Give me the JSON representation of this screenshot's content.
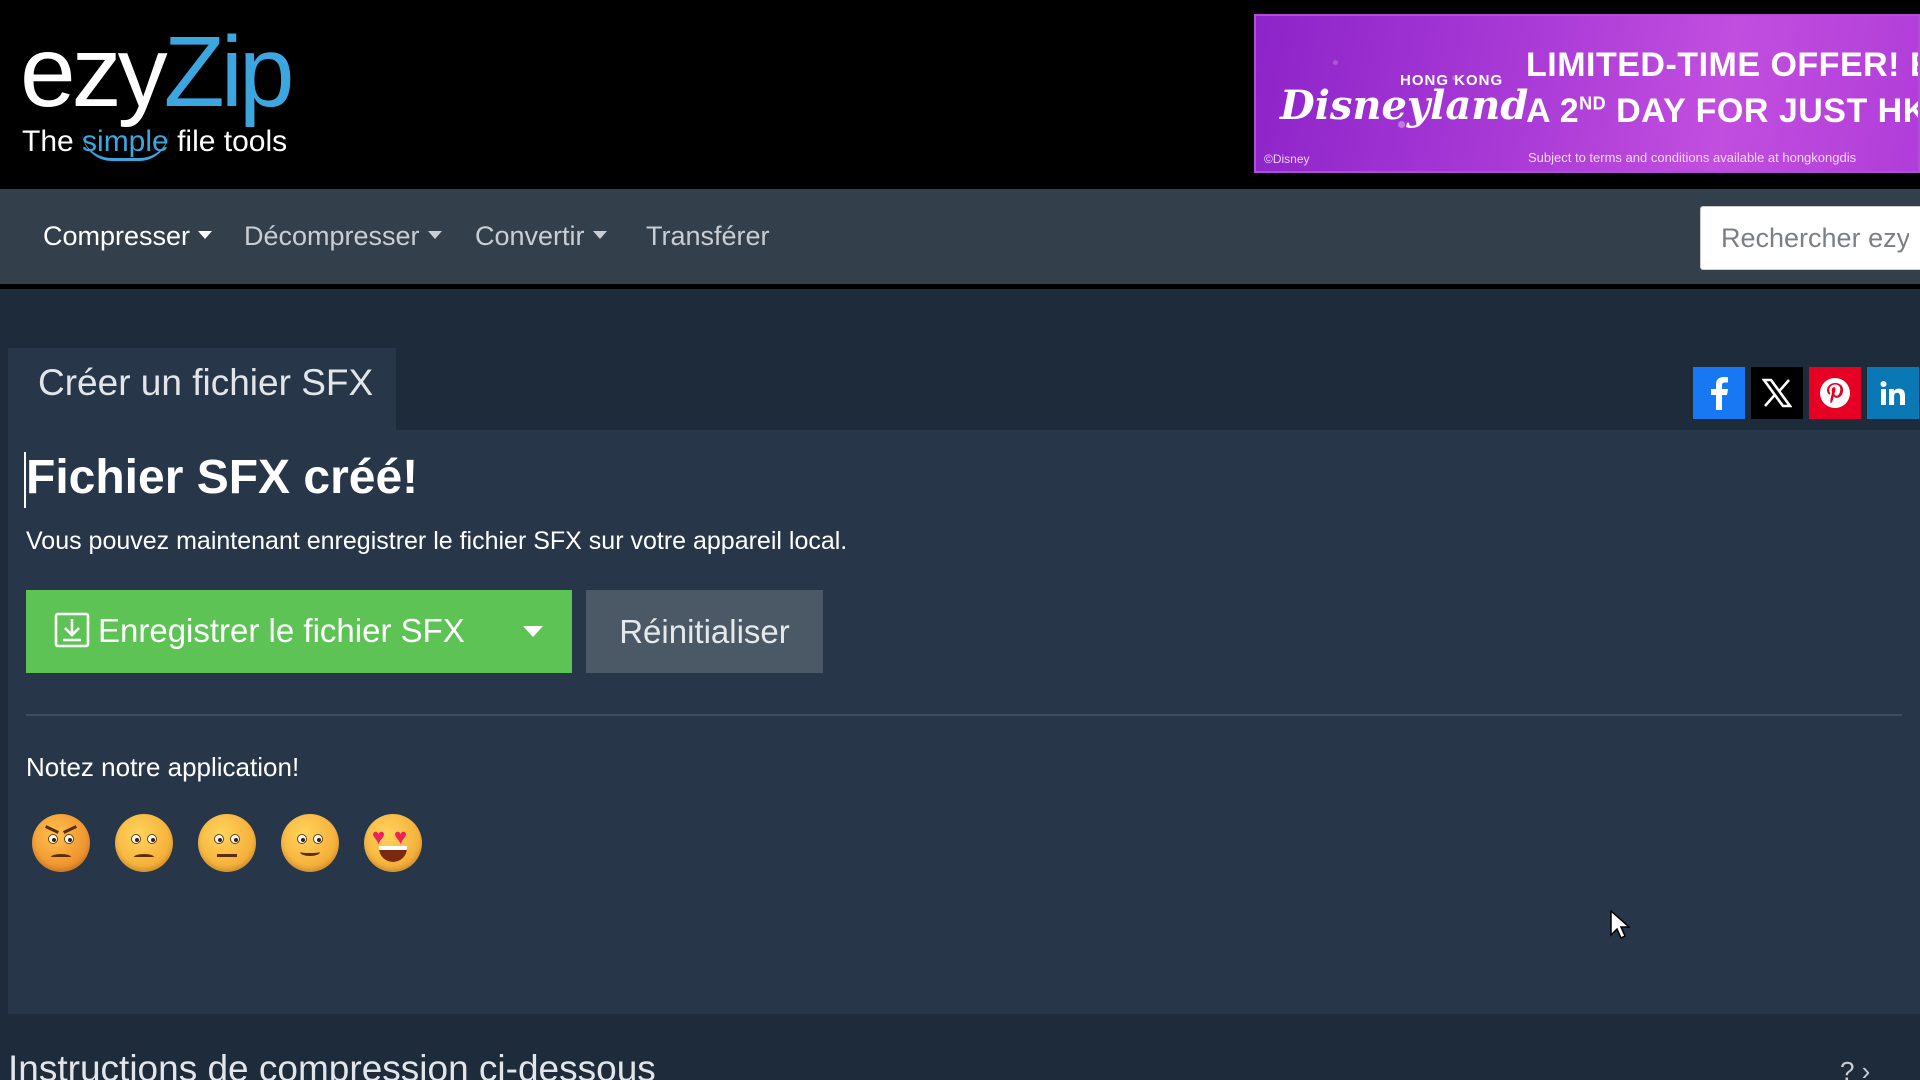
{
  "logo": {
    "part1": "ezy",
    "part2": "Zip",
    "tag_before": "The ",
    "tag_highlight": "simple",
    "tag_after": " file tools"
  },
  "ad": {
    "brand_small": "HONG KONG",
    "brand_name": "Disneyland",
    "line1": "LIMITED-TIME OFFER! EN",
    "line2_a": "A 2",
    "line2_sup": "ND",
    "line2_b": " DAY FOR JUST HK$",
    "fineprint": "Subject to terms and conditions available at hongkongdis",
    "copyright": "©Disney"
  },
  "nav": {
    "items": [
      {
        "label": "Compresser",
        "dropdown": true
      },
      {
        "label": "Décompresser",
        "dropdown": true
      },
      {
        "label": "Convertir",
        "dropdown": true
      },
      {
        "label": "Transférer",
        "dropdown": false
      }
    ],
    "search_placeholder": "Rechercher ezyZ"
  },
  "tab": {
    "label": "Créer un fichier SFX"
  },
  "social": [
    "facebook-icon",
    "x-icon",
    "pinterest-icon",
    "linkedin-icon"
  ],
  "main": {
    "title": "Fichier SFX créé!",
    "subtitle": "Vous pouvez maintenant enregistrer le fichier SFX sur votre appareil local.",
    "save_label": "Enregistrer le fichier SFX",
    "reset_label": "Réinitialiser",
    "rating_label": "Notez notre application!"
  },
  "footer": {
    "instructions": "Instructions de compression ci-dessous",
    "right_text": "? ›"
  },
  "colors": {
    "background": "#1e2b3b",
    "card": "#273648",
    "nav": "#343f4c",
    "save": "#5cc354",
    "reset": "#4b5866",
    "brand_blue": "#3ea6df"
  }
}
